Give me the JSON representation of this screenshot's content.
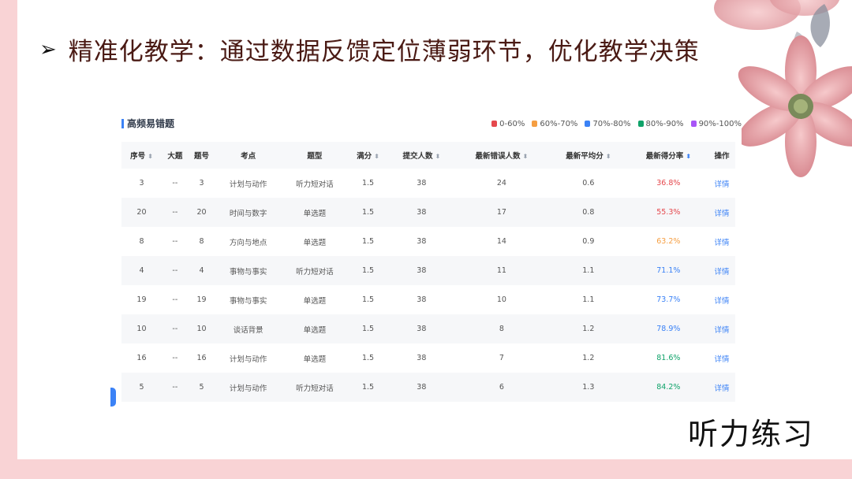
{
  "slide": {
    "heading_bullet": "➢",
    "heading": "精准化教学：通过数据反馈定位薄弱环节，优化教学决策",
    "footer": "听力练习"
  },
  "panel": {
    "title": "高频易错题",
    "legend": [
      {
        "label": "0-60%",
        "color": "#e5484d"
      },
      {
        "label": "60%-70%",
        "color": "#f59e42"
      },
      {
        "label": "70%-80%",
        "color": "#3b82f6"
      },
      {
        "label": "80%-90%",
        "color": "#10a36a"
      },
      {
        "label": "90%-100%",
        "color": "#a855f7"
      }
    ]
  },
  "table": {
    "headers": [
      "序号",
      "大题",
      "题号",
      "考点",
      "题型",
      "满分",
      "提交人数",
      "最新错误人数",
      "最新平均分",
      "最新得分率",
      "操作"
    ],
    "sortable": [
      true,
      false,
      false,
      false,
      false,
      true,
      true,
      true,
      true,
      true,
      false
    ],
    "rows": [
      {
        "seq": "3",
        "section": "--",
        "num": "3",
        "point": "计划与动作",
        "type": "听力短对话",
        "full": "1.5",
        "submit": "38",
        "wrong": "24",
        "avg": "0.6",
        "rate": "36.8%",
        "rate_color": "#e5484d",
        "action": "详情"
      },
      {
        "seq": "20",
        "section": "--",
        "num": "20",
        "point": "时间与数字",
        "type": "单选题",
        "full": "1.5",
        "submit": "38",
        "wrong": "17",
        "avg": "0.8",
        "rate": "55.3%",
        "rate_color": "#e5484d",
        "action": "详情"
      },
      {
        "seq": "8",
        "section": "--",
        "num": "8",
        "point": "方向与地点",
        "type": "单选题",
        "full": "1.5",
        "submit": "38",
        "wrong": "14",
        "avg": "0.9",
        "rate": "63.2%",
        "rate_color": "#f59e42",
        "action": "详情"
      },
      {
        "seq": "4",
        "section": "--",
        "num": "4",
        "point": "事物与事实",
        "type": "听力短对话",
        "full": "1.5",
        "submit": "38",
        "wrong": "11",
        "avg": "1.1",
        "rate": "71.1%",
        "rate_color": "#3b82f6",
        "action": "详情"
      },
      {
        "seq": "19",
        "section": "--",
        "num": "19",
        "point": "事物与事实",
        "type": "单选题",
        "full": "1.5",
        "submit": "38",
        "wrong": "10",
        "avg": "1.1",
        "rate": "73.7%",
        "rate_color": "#3b82f6",
        "action": "详情"
      },
      {
        "seq": "10",
        "section": "--",
        "num": "10",
        "point": "谈话背景",
        "type": "单选题",
        "full": "1.5",
        "submit": "38",
        "wrong": "8",
        "avg": "1.2",
        "rate": "78.9%",
        "rate_color": "#3b82f6",
        "action": "详情"
      },
      {
        "seq": "16",
        "section": "--",
        "num": "16",
        "point": "计划与动作",
        "type": "单选题",
        "full": "1.5",
        "submit": "38",
        "wrong": "7",
        "avg": "1.2",
        "rate": "81.6%",
        "rate_color": "#10a36a",
        "action": "详情"
      },
      {
        "seq": "5",
        "section": "--",
        "num": "5",
        "point": "计划与动作",
        "type": "听力短对话",
        "full": "1.5",
        "submit": "38",
        "wrong": "6",
        "avg": "1.3",
        "rate": "84.2%",
        "rate_color": "#10a36a",
        "action": "详情"
      }
    ]
  }
}
